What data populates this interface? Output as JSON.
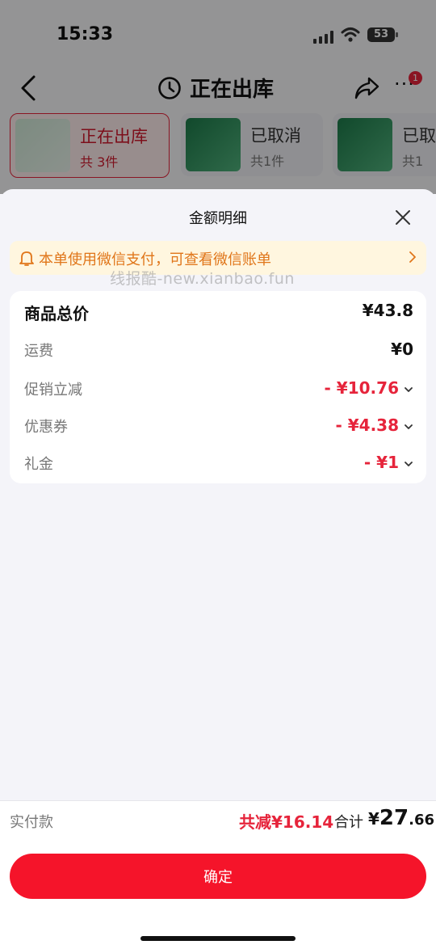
{
  "status_bar": {
    "time": "15:33",
    "battery": "53"
  },
  "nav": {
    "title": "正在出库",
    "badge": "1"
  },
  "tabs": [
    {
      "name": "正在出库",
      "count": "共 3件"
    },
    {
      "name": "已取消",
      "count": "共1件"
    },
    {
      "name": "已取",
      "count": "共1"
    }
  ],
  "sheet": {
    "title": "金额明细",
    "notice": "本单使用微信支付，可查看微信账单",
    "watermark": "线报酷-new.xianbao.fun",
    "rows": [
      {
        "label": "商品总价",
        "value": "¥43.8"
      },
      {
        "label": "运费",
        "value": "¥0"
      },
      {
        "label": "促销立减",
        "value": "- ¥10.76"
      },
      {
        "label": "优惠券",
        "value": "- ¥4.38"
      },
      {
        "label": "礼金",
        "value": "- ¥1"
      }
    ]
  },
  "footer": {
    "paid_label": "实付款",
    "discount": "共减¥16.14",
    "total_label": "合计",
    "total_currency": "¥",
    "total_int": "27",
    "total_dec": ".66",
    "confirm": "确定"
  },
  "colors": {
    "accent": "#e6243b",
    "button": "#f5142a",
    "notice_text": "#e0761a",
    "notice_bg": "#fff6df"
  }
}
